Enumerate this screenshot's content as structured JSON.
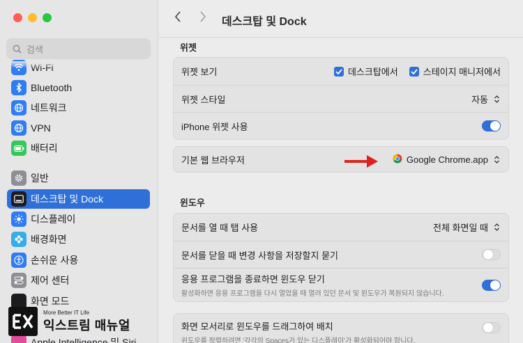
{
  "sidebar": {
    "search_placeholder": "검색",
    "items": [
      {
        "label": "Wi-Fi",
        "icon": "wifi-icon",
        "color": "#2f7cf6"
      },
      {
        "label": "Bluetooth",
        "icon": "bluetooth-icon",
        "color": "#2f7cf6"
      },
      {
        "label": "네트워크",
        "icon": "globe-icon",
        "color": "#2f7cf6"
      },
      {
        "label": "VPN",
        "icon": "vpn-globe-icon",
        "color": "#2f7cf6"
      },
      {
        "label": "배터리",
        "icon": "battery-icon",
        "color": "#34c759"
      },
      {
        "label": "일반",
        "icon": "gear-icon",
        "color": "#8e8e93"
      },
      {
        "label": "데스크탑 및 Dock",
        "icon": "dock-icon",
        "color": "#1c1c1e"
      },
      {
        "label": "디스플레이",
        "icon": "sun-icon",
        "color": "#2f7cf6"
      },
      {
        "label": "배경화면",
        "icon": "flower-icon",
        "color": "#35aee8"
      },
      {
        "label": "손쉬운 사용",
        "icon": "accessibility-icon",
        "color": "#2f7cf6"
      },
      {
        "label": "제어 센터",
        "icon": "control-center-icon",
        "color": "#8e8e93"
      },
      {
        "label": "화면 모드",
        "icon": "screen-mode-icon",
        "color": "#1c1c1e"
      },
      {
        "label": "Apple Intelligence 및 Siri",
        "icon": "siri-icon",
        "color": "#e34b9b"
      }
    ]
  },
  "toolbar": {
    "title": "데스크탑 및 Dock"
  },
  "widgets": {
    "section_title": "위젯",
    "show_widgets_label": "위젯 보기",
    "on_desktop_label": "데스크탑에서",
    "on_stage_manager_label": "스테이지 매니저에서",
    "widget_style_label": "위젯 스타일",
    "widget_style_value": "자동",
    "iphone_widgets_label": "iPhone 위젯 사용",
    "iphone_widgets_on": true
  },
  "browser": {
    "default_browser_label": "기본 웹 브라우저",
    "default_browser_value": "Google Chrome.app"
  },
  "windows": {
    "section_title": "윈도우",
    "prefer_tabs_label": "문서를 열 때 탭 사용",
    "prefer_tabs_value": "전체 화면일 때",
    "ask_keep_changes_label": "문서를 닫을 때 변경 사항을 저장할지 묻기",
    "ask_keep_changes_on": false,
    "close_windows_label": "응용 프로그램을 종료하면 윈도우 닫기",
    "close_windows_sub": "활성화하면 응용 프로그램을 다시 열었을 때 열려 있던 문서 및 윈도우가 복원되지 않습니다.",
    "close_windows_on": true,
    "drag_tile_label": "화면 모서리로 윈도우를 드래그하여 배치",
    "drag_tile_sub": "윈도우를 정렬하려면 '각각의 Spaces가 있는 디스플레이'가 활성화되어야 합니다.",
    "drag_tile_on": false
  },
  "watermark": {
    "logo_letters": "EX",
    "tagline": "More Better IT Life",
    "brand": "익스트림 매뉴얼"
  },
  "colors": {
    "accent": "#2f6fd8",
    "arrow": "#e0201c"
  }
}
